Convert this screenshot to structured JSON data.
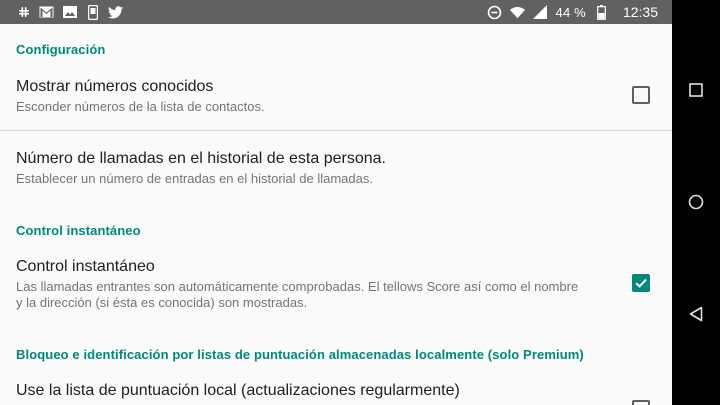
{
  "status_bar": {
    "battery_text": "44 %",
    "time": "12:35",
    "left_icons": [
      "slack-icon",
      "gmail-icon",
      "image-icon",
      "phone-icon",
      "twitter-icon"
    ],
    "right_icons": [
      "data-saver-icon",
      "wifi-icon",
      "signal-icon",
      "battery-icon"
    ]
  },
  "settings": {
    "cat_config": "Configuración",
    "known_title": "Mostrar números conocidos",
    "known_summary": "Esconder números de la lista de contactos.",
    "known_checked": false,
    "history_title": "Número de llamadas en el historial de esta persona.",
    "history_summary": "Establecer un número de entradas en el historial de llamadas.",
    "cat_instant": "Control instantáneo",
    "instant_title": "Control instantáneo",
    "instant_summary": "Las llamadas entrantes son automáticamente comprobadas. El tellows Score así como el nombre y la dirección (si ésta es conocida) son mostradas.",
    "instant_checked": true,
    "cat_block": "Bloqueo e identificación por listas de puntuación almacenadas localmente (solo Premium)",
    "local_title": "Use la lista de puntuación local (actualizaciones regularmente)",
    "local_checked": false
  },
  "colors": {
    "accent": "#00897b",
    "status_bar": "#616161",
    "background": "#fafafa"
  }
}
